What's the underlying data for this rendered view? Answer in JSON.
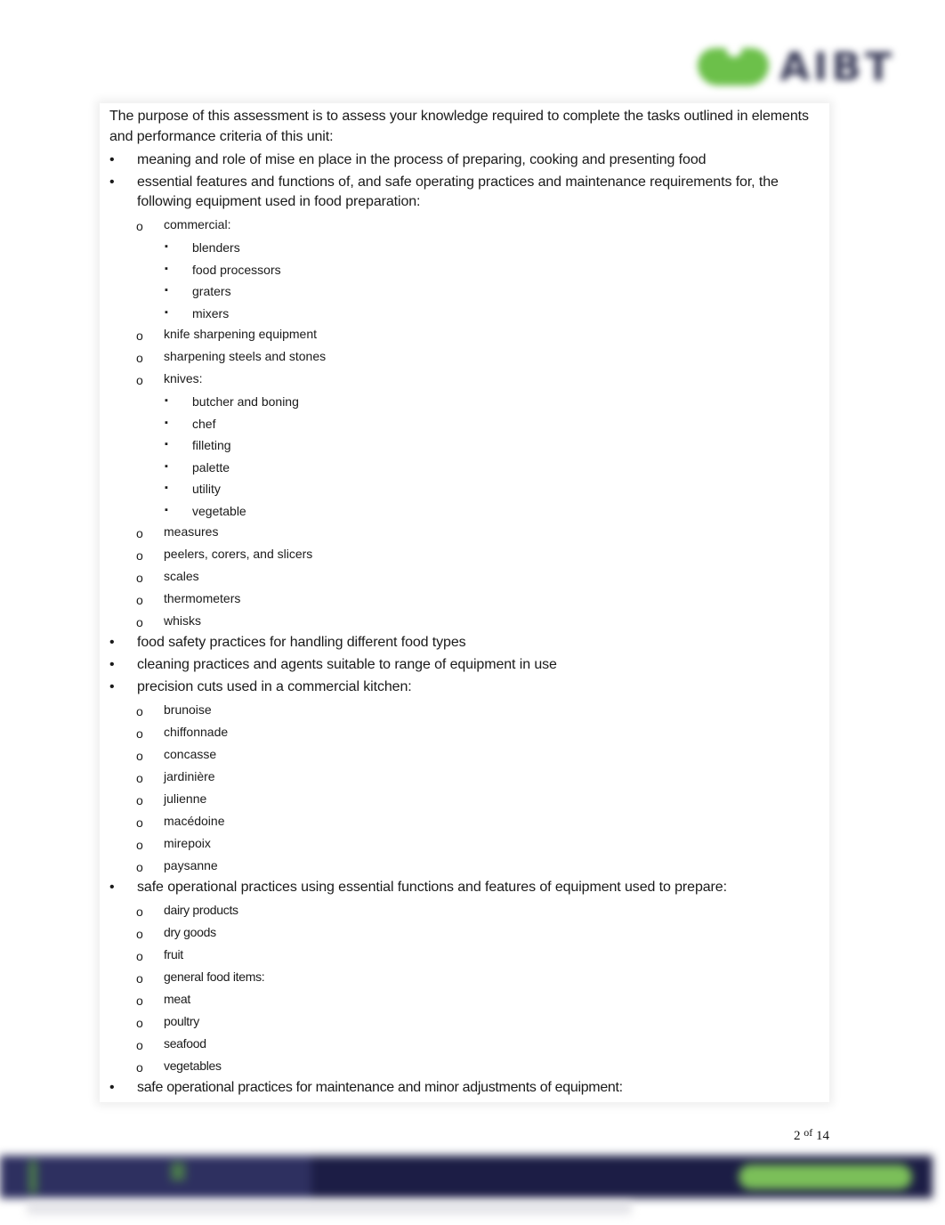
{
  "header": {
    "logo_text": "AIBT",
    "logo_color": "#6cc04a"
  },
  "intro": "The purpose of this assessment is to assess your knowledge required to complete the tasks outlined in elements and performance criteria of this unit:",
  "markers": {
    "level1": "•",
    "level2": "o",
    "level3": "▪"
  },
  "items": [
    {
      "level": 1,
      "text": "meaning and role of mise en place in the process of preparing, cooking and presenting food"
    },
    {
      "level": 1,
      "text": "essential features and functions of, and safe operating practices and maintenance requirements for, the following equipment used in food preparation:"
    },
    {
      "level": 2,
      "text": "commercial:"
    },
    {
      "level": 3,
      "text": "blenders"
    },
    {
      "level": 3,
      "text": "food processors"
    },
    {
      "level": 3,
      "text": "graters"
    },
    {
      "level": 3,
      "text": "mixers"
    },
    {
      "level": 2,
      "text": "knife sharpening equipment"
    },
    {
      "level": 2,
      "text": "sharpening steels and stones"
    },
    {
      "level": 2,
      "text": "knives:"
    },
    {
      "level": 3,
      "text": "butcher and boning"
    },
    {
      "level": 3,
      "text": "chef"
    },
    {
      "level": 3,
      "text": "filleting"
    },
    {
      "level": 3,
      "text": "palette"
    },
    {
      "level": 3,
      "text": "utility"
    },
    {
      "level": 3,
      "text": "vegetable"
    },
    {
      "level": 2,
      "text": "measures"
    },
    {
      "level": 2,
      "text": "peelers, corers, and slicers"
    },
    {
      "level": 2,
      "text": "scales"
    },
    {
      "level": 2,
      "text": "thermometers"
    },
    {
      "level": 2,
      "text": "whisks"
    },
    {
      "level": 1,
      "text": "food safety practices for handling different food types"
    },
    {
      "level": 1,
      "text": "cleaning practices and agents suitable to range of equipment in use"
    },
    {
      "level": 1,
      "text": "precision cuts used in a commercial kitchen:"
    },
    {
      "level": 2,
      "text": "brunoise"
    },
    {
      "level": 2,
      "text": "chiffonnade"
    },
    {
      "level": 2,
      "text": "concasse"
    },
    {
      "level": 2,
      "text": "jardinière"
    },
    {
      "level": 2,
      "text": "julienne"
    },
    {
      "level": 2,
      "text": "macédoine"
    },
    {
      "level": 2,
      "text": "mirepoix"
    },
    {
      "level": 2,
      "text": "paysanne"
    },
    {
      "level": 1,
      "text": "safe operational practices using essential functions and features of equipment used to prepare:"
    },
    {
      "level": 2,
      "text": "dairy products"
    },
    {
      "level": 2,
      "text": "dry goods"
    },
    {
      "level": 2,
      "text": "fruit"
    },
    {
      "level": 2,
      "text": "general food items:"
    },
    {
      "level": 2,
      "text": "meat"
    },
    {
      "level": 2,
      "text": "poultry"
    },
    {
      "level": 2,
      "text": "seafood"
    },
    {
      "level": 2,
      "text": "vegetables"
    },
    {
      "level": 1,
      "text": "safe operational practices for maintenance and minor adjustments of equipment:"
    }
  ],
  "page": {
    "current": "2",
    "of_label": "of",
    "total": "14"
  },
  "footer": {
    "band_color": "#1c1d45",
    "accent_color": "#7bbf59"
  }
}
